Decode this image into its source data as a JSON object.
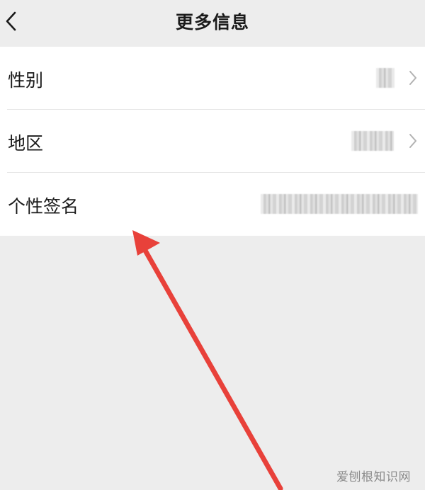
{
  "header": {
    "title": "更多信息"
  },
  "rows": [
    {
      "label": "性别",
      "has_chevron": true
    },
    {
      "label": "地区",
      "has_chevron": true
    },
    {
      "label": "个性签名",
      "has_chevron": false
    }
  ],
  "icons": {
    "back": "chevron-left-icon",
    "row_arrow": "chevron-right-icon"
  },
  "annotation": {
    "arrow_color": "#e8413a"
  },
  "watermark": {
    "text": "爱刨根知识网"
  }
}
